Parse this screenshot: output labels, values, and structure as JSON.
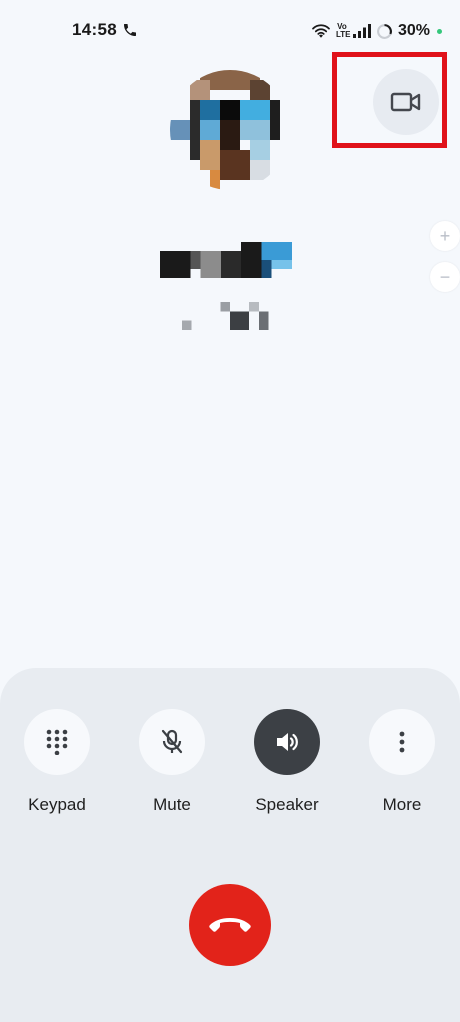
{
  "status_bar": {
    "time": "14:58",
    "network_label": "Vo LTE",
    "battery": "30%"
  },
  "call": {
    "buttons": [
      {
        "label": "Keypad",
        "icon": "dialpad-icon",
        "active": false
      },
      {
        "label": "Mute",
        "icon": "mic-off-icon",
        "active": false
      },
      {
        "label": "Speaker",
        "icon": "speaker-icon",
        "active": true
      },
      {
        "label": "More",
        "icon": "more-vert-icon",
        "active": false
      }
    ],
    "video_icon": "videocam-icon",
    "end_call_icon": "call-end-icon"
  },
  "zoom": {
    "in_label": "+",
    "out_label": "−"
  },
  "colors": {
    "background": "#f5f8fc",
    "panel": "#e8ecf1",
    "end_call": "#e2231a",
    "speaker_active": "#3c4045",
    "highlight": "#e0121a"
  }
}
